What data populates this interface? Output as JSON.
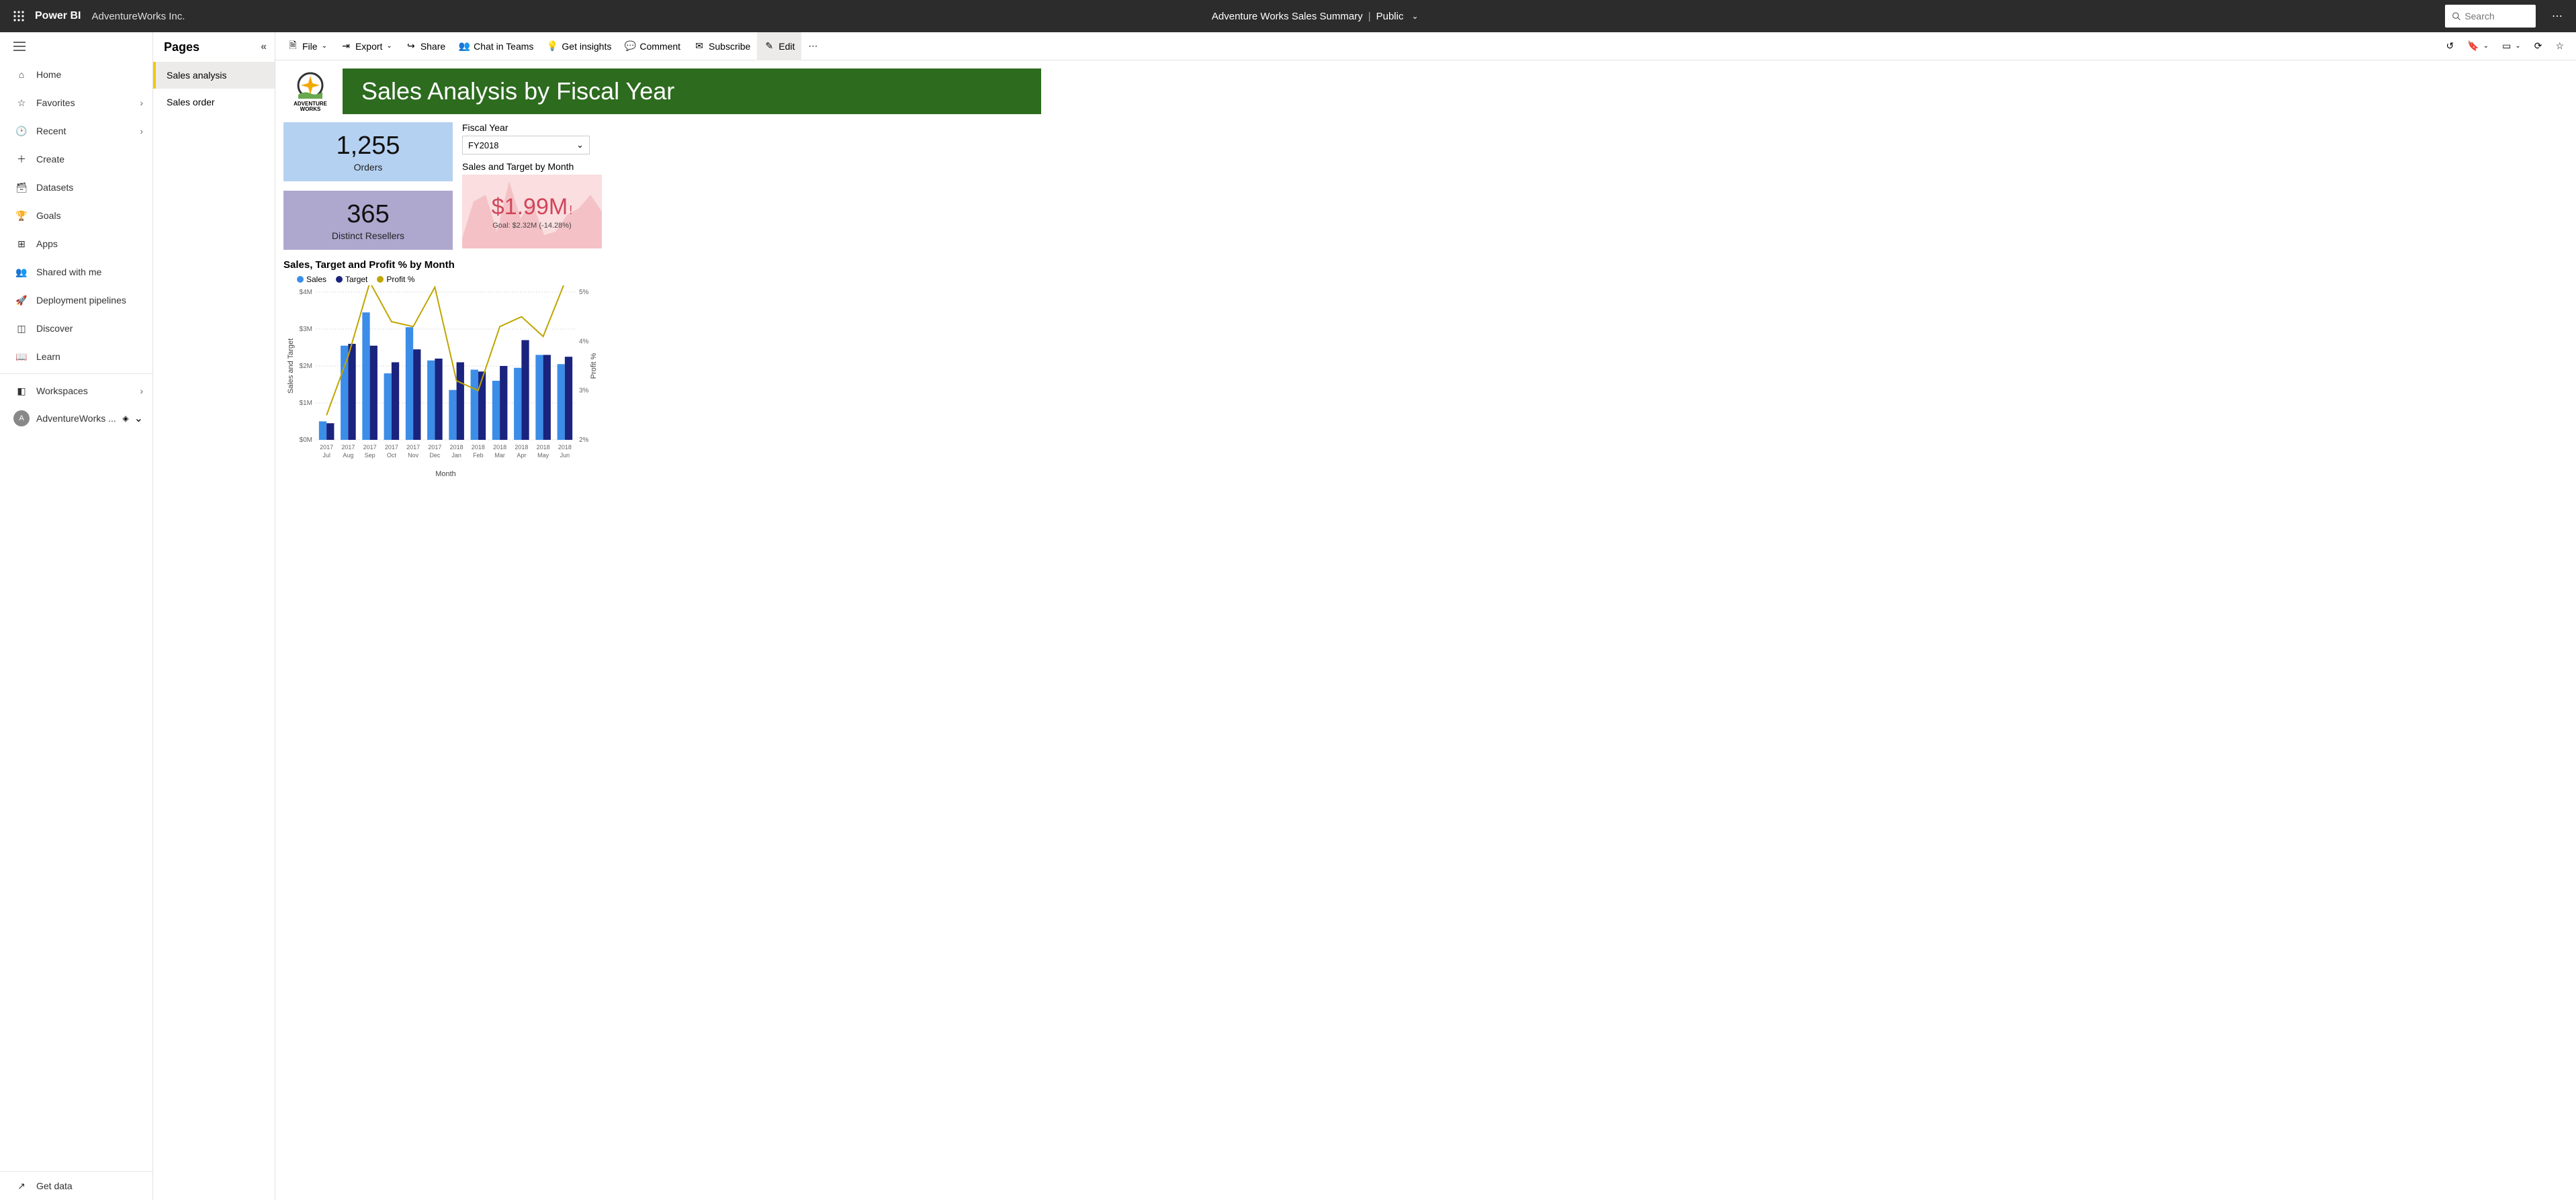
{
  "header": {
    "product": "Power BI",
    "workspace": "AdventureWorks Inc.",
    "report_title": "Adventure Works Sales Summary",
    "visibility": "Public",
    "search_placeholder": "Search"
  },
  "nav": {
    "home": "Home",
    "favorites": "Favorites",
    "recent": "Recent",
    "create": "Create",
    "datasets": "Datasets",
    "goals": "Goals",
    "apps": "Apps",
    "shared": "Shared with me",
    "pipelines": "Deployment pipelines",
    "discover": "Discover",
    "learn": "Learn",
    "workspaces": "Workspaces",
    "current_ws": "AdventureWorks ...",
    "get_data": "Get data"
  },
  "pages": {
    "title": "Pages",
    "items": [
      {
        "label": "Sales analysis",
        "active": true
      },
      {
        "label": "Sales order",
        "active": false
      }
    ]
  },
  "toolbar": {
    "file": "File",
    "export": "Export",
    "share": "Share",
    "chat": "Chat in Teams",
    "insights": "Get insights",
    "comment": "Comment",
    "subscribe": "Subscribe",
    "edit": "Edit"
  },
  "report": {
    "logo_text": "ADVENTURE WORKS",
    "title": "Sales Analysis by Fiscal Year",
    "cards": {
      "orders_value": "1,255",
      "orders_label": "Orders",
      "resellers_value": "365",
      "resellers_label": "Distinct Resellers"
    },
    "fiscal_year_label": "Fiscal Year",
    "fiscal_year_value": "FY2018",
    "kpi": {
      "title": "Sales and Target by Month",
      "value": "$1.99M",
      "goal": "Goal: $2.32M (-14.28%)"
    },
    "chart": {
      "title": "Sales, Target and Profit % by Month",
      "legend_sales": "Sales",
      "legend_target": "Target",
      "legend_profit": "Profit %",
      "y_label": "Sales and Target",
      "y2_label": "Profit %",
      "x_label": "Month"
    }
  },
  "chart_data": {
    "type": "bar",
    "categories": [
      "2017 Jul",
      "2017 Aug",
      "2017 Sep",
      "2017 Oct",
      "2017 Nov",
      "2017 Dec",
      "2018 Jan",
      "2018 Feb",
      "2018 Mar",
      "2018 Apr",
      "2018 May",
      "2018 Jun"
    ],
    "series": [
      {
        "name": "Sales",
        "values": [
          0.5,
          2.55,
          3.45,
          1.8,
          3.05,
          2.15,
          1.35,
          1.9,
          1.6,
          1.95,
          2.3,
          2.05
        ]
      },
      {
        "name": "Target",
        "values": [
          0.45,
          2.6,
          2.55,
          2.1,
          2.45,
          2.2,
          2.1,
          1.85,
          2.0,
          2.7,
          2.3,
          2.25
        ]
      },
      {
        "name": "Profit %",
        "values": [
          2.5,
          3.7,
          5.2,
          4.4,
          4.3,
          5.1,
          3.2,
          3.0,
          4.3,
          4.5,
          4.1,
          5.2
        ]
      }
    ],
    "ylabel": "Sales and Target",
    "y2label": "Profit %",
    "xlabel": "Month",
    "ylim": [
      0,
      4
    ],
    "y2lim": [
      2,
      5
    ],
    "yticks": [
      "$0M",
      "$1M",
      "$2M",
      "$3M",
      "$4M"
    ],
    "y2ticks": [
      "2%",
      "3%",
      "4%",
      "5%"
    ]
  }
}
